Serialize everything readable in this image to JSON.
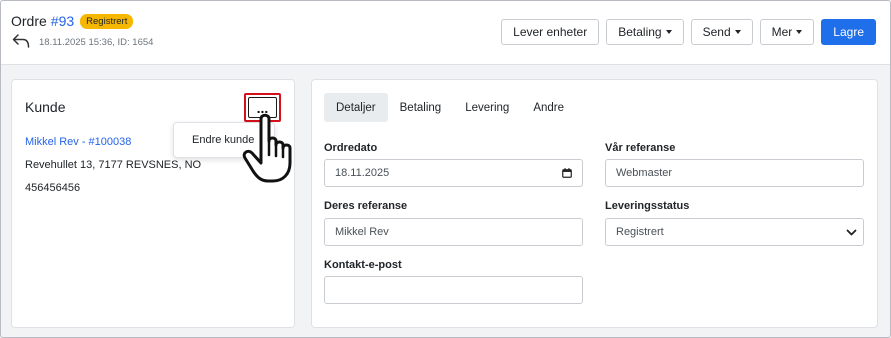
{
  "header": {
    "title": "Ordre",
    "order_no": "#93",
    "status_badge": "Registrert",
    "meta": "18.11.2025 15:36, ID: 1654",
    "buttons": {
      "lever": "Lever enheter",
      "betaling": "Betaling",
      "send": "Send",
      "mer": "Mer",
      "lagre": "Lagre"
    }
  },
  "customer": {
    "title": "Kunde",
    "more_label": "...",
    "name_link": "Mikkel Rev - #100038",
    "address": "Revehullet 13, 7177 REVSNES, NO",
    "phone": "456456456",
    "menu": {
      "edit": "Endre kunde"
    }
  },
  "details": {
    "tabs": [
      "Detaljer",
      "Betaling",
      "Levering",
      "Andre"
    ],
    "active_tab": "Detaljer",
    "fields": {
      "ordredato": {
        "label": "Ordredato",
        "value": "18.11.2025"
      },
      "var_referanse": {
        "label": "Vår referanse",
        "value": "Webmaster"
      },
      "deres_referanse": {
        "label": "Deres referanse",
        "value": "Mikkel Rev"
      },
      "leveringsstatus": {
        "label": "Leveringsstatus",
        "value": "Registrert"
      },
      "kontakt_epost": {
        "label": "Kontakt-e-post",
        "value": ""
      }
    }
  },
  "colors": {
    "accent": "#1f6feb",
    "badge": "#f6b700",
    "highlight": "#d4101a"
  },
  "icons": {
    "back": "back-arrow-icon",
    "more": "ellipsis-icon",
    "calendar": "calendar-icon",
    "select": "chevron-down-icon",
    "cursor": "hand-pointer-icon"
  }
}
